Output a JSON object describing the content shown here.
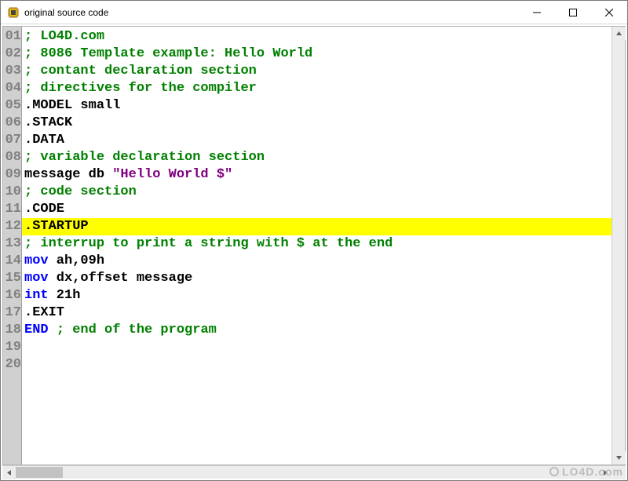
{
  "window": {
    "title": "original source code"
  },
  "lines": [
    {
      "num": "01",
      "segments": [
        {
          "cls": "c-comment",
          "t": "; LO4D.com"
        }
      ]
    },
    {
      "num": "02",
      "segments": [
        {
          "cls": "c-comment",
          "t": "; 8086 Template example: Hello World"
        }
      ]
    },
    {
      "num": "03",
      "segments": [
        {
          "cls": "c-comment",
          "t": "; contant declaration section"
        }
      ]
    },
    {
      "num": "04",
      "segments": [
        {
          "cls": "c-comment",
          "t": "; directives for the compiler"
        }
      ]
    },
    {
      "num": "05",
      "segments": [
        {
          "cls": "c-black",
          "t": ".MODEL small"
        }
      ]
    },
    {
      "num": "06",
      "segments": [
        {
          "cls": "c-black",
          "t": ".STACK"
        }
      ]
    },
    {
      "num": "07",
      "segments": [
        {
          "cls": "c-black",
          "t": ".DATA"
        }
      ]
    },
    {
      "num": "08",
      "segments": [
        {
          "cls": "c-comment",
          "t": "; variable declaration section"
        }
      ]
    },
    {
      "num": "09",
      "segments": [
        {
          "cls": "c-black",
          "t": "message db "
        },
        {
          "cls": "c-string",
          "t": "\"Hello World $\""
        }
      ]
    },
    {
      "num": "10",
      "segments": [
        {
          "cls": "c-comment",
          "t": "; code section"
        }
      ]
    },
    {
      "num": "11",
      "segments": [
        {
          "cls": "c-black",
          "t": ".CODE"
        }
      ]
    },
    {
      "num": "12",
      "highlight": true,
      "segments": [
        {
          "cls": "c-black",
          "t": ".STARTUP"
        }
      ]
    },
    {
      "num": "13",
      "segments": [
        {
          "cls": "c-comment",
          "t": "; interrup to print a string with $ at the end"
        }
      ]
    },
    {
      "num": "14",
      "segments": [
        {
          "cls": "c-kw",
          "t": "mov"
        },
        {
          "cls": "c-black",
          "t": " ah,09h"
        }
      ]
    },
    {
      "num": "15",
      "segments": [
        {
          "cls": "c-kw",
          "t": "mov"
        },
        {
          "cls": "c-black",
          "t": " dx,offset message"
        }
      ]
    },
    {
      "num": "16",
      "segments": [
        {
          "cls": "c-kw",
          "t": "int"
        },
        {
          "cls": "c-black",
          "t": " 21h"
        }
      ]
    },
    {
      "num": "17",
      "segments": [
        {
          "cls": "c-black",
          "t": ".EXIT"
        }
      ]
    },
    {
      "num": "18",
      "segments": [
        {
          "cls": "c-kw",
          "t": "END"
        },
        {
          "cls": "c-black",
          "t": " "
        },
        {
          "cls": "c-comment",
          "t": "; end of the program"
        }
      ]
    },
    {
      "num": "19",
      "segments": []
    },
    {
      "num": "20",
      "segments": []
    }
  ],
  "watermark": "LO4D.com"
}
